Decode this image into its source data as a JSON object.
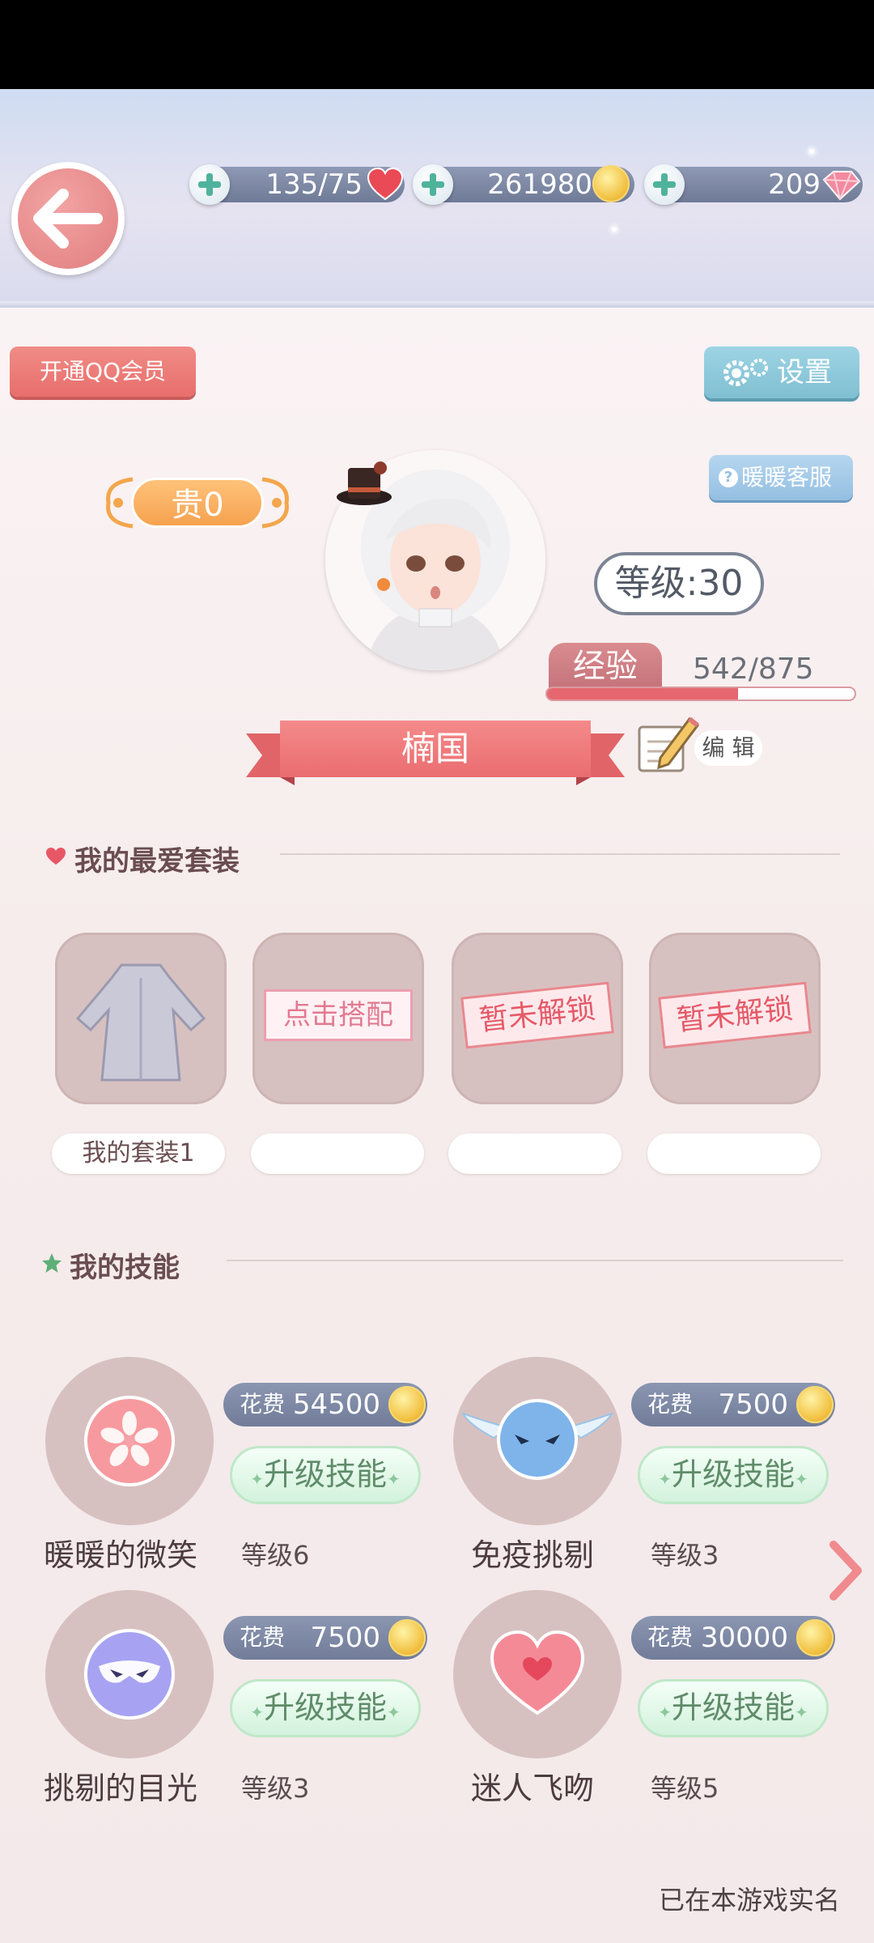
{
  "resources": {
    "stamina": "135/75",
    "gold": "261980",
    "diamonds": "209"
  },
  "buttons": {
    "qq_vip": "开通QQ会员",
    "settings": "设置",
    "customer_service": "暖暖客服"
  },
  "profile": {
    "vip": "贵0",
    "level": "等级:30",
    "exp_label": "经验",
    "exp_value": "542/875",
    "exp_progress": 0.62,
    "name": "楠国",
    "edit": "编 辑"
  },
  "favorite_outfits": {
    "title": "我的最爱套装",
    "slots": [
      {
        "label": "我的套装1",
        "state": "outfit"
      },
      {
        "label": "",
        "state": "点击搭配"
      },
      {
        "label": "",
        "state": "暂未解锁"
      },
      {
        "label": "",
        "state": "暂未解锁"
      }
    ]
  },
  "skills": {
    "title": "我的技能",
    "cost_label": "花费",
    "upgrade_label": "升级技能",
    "items": [
      {
        "name": "暖暖的微笑",
        "level": "等级6",
        "cost": "54500",
        "icon": "sakura-icon"
      },
      {
        "name": "免疫挑剔",
        "level": "等级3",
        "cost": "7500",
        "icon": "winged-mask-icon"
      },
      {
        "name": "挑剔的目光",
        "level": "等级3",
        "cost": "7500",
        "icon": "purple-mask-icon"
      },
      {
        "name": "迷人飞吻",
        "level": "等级5",
        "cost": "30000",
        "icon": "heart-icon"
      }
    ]
  },
  "footer": {
    "real_name": "已在本游戏实名"
  },
  "colors": {
    "accent_pink": "#ea6d70",
    "settings_blue": "#7fbfd2",
    "upgrade_green": "#d3f2dc"
  }
}
